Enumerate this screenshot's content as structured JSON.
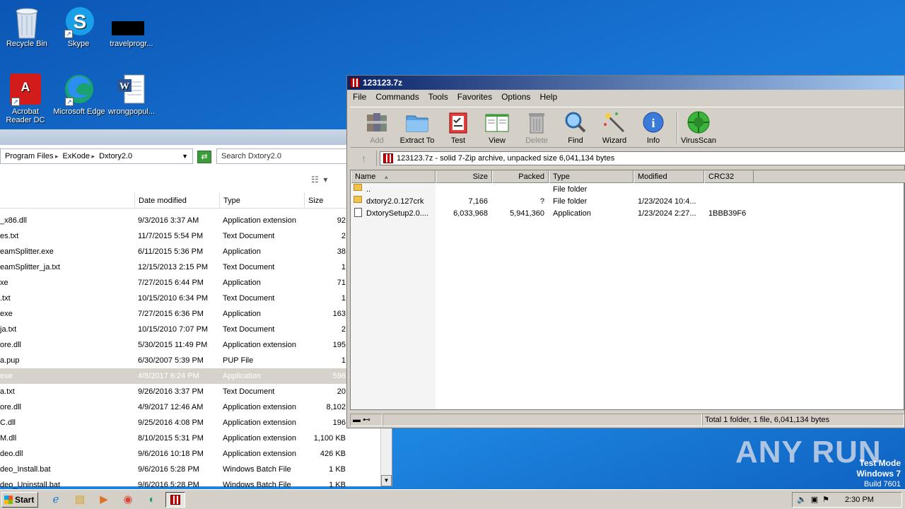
{
  "desktop": {
    "icons": [
      {
        "name": "recycle-bin",
        "label": "Recycle Bin"
      },
      {
        "name": "skype",
        "label": "Skype"
      },
      {
        "name": "travelprogr",
        "label": "travelprogr..."
      },
      {
        "name": "acrobat",
        "label": "Acrobat Reader DC"
      },
      {
        "name": "edge",
        "label": "Microsoft Edge"
      },
      {
        "name": "wrongpopul",
        "label": "wrongpopul..."
      }
    ],
    "watermark": {
      "line1": "Test Mode",
      "line2": "Windows 7",
      "line3": "Build 7601"
    },
    "anyrun": "ANY RUN"
  },
  "explorer": {
    "breadcrumb": [
      "Program Files",
      "ExKode",
      "Dxtory2.0"
    ],
    "search_placeholder": "Search Dxtory2.0",
    "columns": {
      "name": "",
      "date": "Date modified",
      "type": "Type",
      "size": "Size"
    },
    "rows": [
      {
        "name": "_x86.dll",
        "date": "9/3/2016 3:37 AM",
        "type": "Application extension",
        "size": "92"
      },
      {
        "name": "es.txt",
        "date": "11/7/2015 5:54 PM",
        "type": "Text Document",
        "size": "2"
      },
      {
        "name": "eamSplitter.exe",
        "date": "6/11/2015 5:36 PM",
        "type": "Application",
        "size": "38"
      },
      {
        "name": "eamSplitter_ja.txt",
        "date": "12/15/2013 2:15 PM",
        "type": "Text Document",
        "size": "1"
      },
      {
        "name": "xe",
        "date": "7/27/2015 6:44 PM",
        "type": "Application",
        "size": "71"
      },
      {
        "name": ".txt",
        "date": "10/15/2010 6:34 PM",
        "type": "Text Document",
        "size": "1"
      },
      {
        "name": "exe",
        "date": "7/27/2015 6:36 PM",
        "type": "Application",
        "size": "163"
      },
      {
        "name": "ja.txt",
        "date": "10/15/2010 7:07 PM",
        "type": "Text Document",
        "size": "2"
      },
      {
        "name": "ore.dll",
        "date": "5/30/2015 11:49 PM",
        "type": "Application extension",
        "size": "195"
      },
      {
        "name": "a.pup",
        "date": "6/30/2007 5:39 PM",
        "type": "PUP File",
        "size": "1"
      },
      {
        "name": "exe",
        "date": "4/8/2017 6:24 PM",
        "type": "Application",
        "size": "596",
        "selected": true
      },
      {
        "name": "a.txt",
        "date": "9/26/2016 3:37 PM",
        "type": "Text Document",
        "size": "20"
      },
      {
        "name": "ore.dll",
        "date": "4/9/2017 12:46 AM",
        "type": "Application extension",
        "size": "8,102"
      },
      {
        "name": "C.dll",
        "date": "9/25/2016 4:08 PM",
        "type": "Application extension",
        "size": "196"
      },
      {
        "name": "M.dll",
        "date": "8/10/2015 5:31 PM",
        "type": "Application extension",
        "size": "1,100 KB"
      },
      {
        "name": "deo.dll",
        "date": "9/6/2016 10:18 PM",
        "type": "Application extension",
        "size": "426 KB"
      },
      {
        "name": "deo_Install.bat",
        "date": "9/6/2016 5:28 PM",
        "type": "Windows Batch File",
        "size": "1 KB"
      },
      {
        "name": "deo_Uninstall.bat",
        "date": "9/6/2016 5:28 PM",
        "type": "Windows Batch File",
        "size": "1 KB"
      }
    ]
  },
  "zip": {
    "title": "123123.7z",
    "menu": [
      "File",
      "Commands",
      "Tools",
      "Favorites",
      "Options",
      "Help"
    ],
    "toolbar": [
      {
        "label": "Add",
        "disabled": true
      },
      {
        "label": "Extract To",
        "disabled": false
      },
      {
        "label": "Test",
        "disabled": false
      },
      {
        "label": "View",
        "disabled": false
      },
      {
        "label": "Delete",
        "disabled": true
      },
      {
        "label": "Find",
        "disabled": false
      },
      {
        "label": "Wizard",
        "disabled": false
      },
      {
        "label": "Info",
        "disabled": false
      },
      {
        "label": "VirusScan",
        "disabled": false
      }
    ],
    "path": "123123.7z - solid 7-Zip archive, unpacked size 6,041,134 bytes",
    "columns": {
      "name": "Name",
      "size": "Size",
      "packed": "Packed",
      "type": "Type",
      "modified": "Modified",
      "crc": "CRC32"
    },
    "rows": [
      {
        "name": "..",
        "size": "",
        "packed": "",
        "type": "File folder",
        "modified": "",
        "crc": "",
        "icon": "folder"
      },
      {
        "name": "dxtory2.0.127crk",
        "size": "7,166",
        "packed": "?",
        "type": "File folder",
        "modified": "1/23/2024 10:4...",
        "crc": "",
        "icon": "folder"
      },
      {
        "name": "DxtorySetup2.0....",
        "size": "6,033,968",
        "packed": "5,941,360",
        "type": "Application",
        "modified": "1/23/2024 2:27...",
        "crc": "1BBB39F6",
        "icon": "file"
      }
    ],
    "status": "Total 1 folder, 1 file, 6,041,134 bytes"
  },
  "taskbar": {
    "start": "Start",
    "clock": "2:30 PM"
  }
}
